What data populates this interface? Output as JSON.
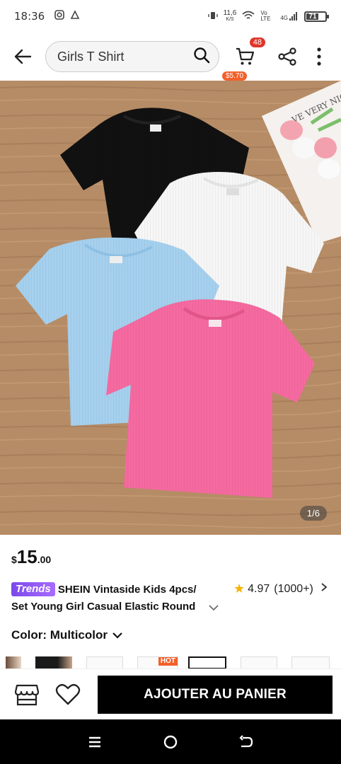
{
  "status_bar": {
    "time": "18:36",
    "speed_value": "11,6",
    "speed_unit": "K/S",
    "network_label": "Vo LTE",
    "signal_label": "4G",
    "battery": "71"
  },
  "header": {
    "search_value": "Girls T Shirt",
    "cart_count": "48",
    "cart_price": "$5.70"
  },
  "gallery": {
    "page_indicator": "1/6",
    "tag_text": "VE VERY NIC"
  },
  "product": {
    "price_currency": "$",
    "price_integer": "15",
    "price_decimal": ".00",
    "badge": "Trends",
    "title_line1": "SHEIN Vintaside Kids 4pcs/",
    "title_line2": "Set Young Girl Casual Elastic Round",
    "rating": "4.97",
    "review_count": "(1000+)",
    "color_label": "Color: Multicolor",
    "swatch_hot_badge": "HOT"
  },
  "actions": {
    "add_to_cart": "AJOUTER AU PANIER"
  },
  "colors": {
    "accent": "#e0352b",
    "price_tag": "#f2602b",
    "trends": "#7b49ea",
    "star": "#f5b301",
    "button": "#000000"
  }
}
